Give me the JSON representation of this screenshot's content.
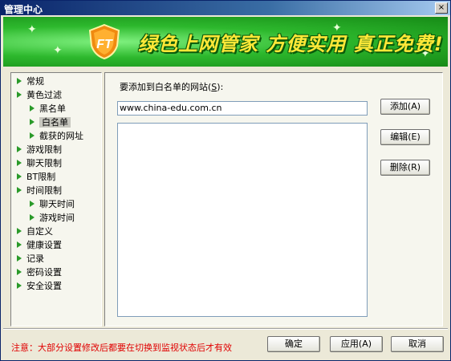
{
  "window": {
    "title": "管理中心",
    "close_label": "×"
  },
  "banner": {
    "slogan": "绿色上网管家  方便实用  真正免费!",
    "logo_text": "FT"
  },
  "tree": {
    "items": [
      {
        "label": "常规"
      },
      {
        "label": "黄色过滤"
      },
      {
        "label": "黑名单"
      },
      {
        "label": "白名单",
        "selected": true
      },
      {
        "label": "截获的网址"
      },
      {
        "label": "游戏限制"
      },
      {
        "label": "聊天限制"
      },
      {
        "label": "BT限制"
      },
      {
        "label": "时间限制"
      },
      {
        "label": "聊天时间"
      },
      {
        "label": "游戏时间"
      },
      {
        "label": "自定义"
      },
      {
        "label": "健康设置"
      },
      {
        "label": "记录"
      },
      {
        "label": "密码设置"
      },
      {
        "label": "安全设置"
      }
    ]
  },
  "whitelist": {
    "prompt_prefix": "要添加到白名单的网站(",
    "prompt_key": "S",
    "prompt_suffix": "):",
    "input_value": "www.china-edu.com.cn",
    "add_label": "添加(A)",
    "edit_label": "编辑(E)",
    "delete_label": "删除(R)"
  },
  "footer": {
    "notice": "注意：大部分设置修改后都要在切换到监视状态后才有效",
    "ok_label": "确定",
    "apply_label": "应用(A)",
    "cancel_label": "取消"
  },
  "colors": {
    "title_bar": "#0a246a",
    "banner_green": "#2db82d",
    "slogan_yellow": "#ffe838",
    "notice_red": "#e00000",
    "tree_arrow": "#2a9a2a"
  }
}
